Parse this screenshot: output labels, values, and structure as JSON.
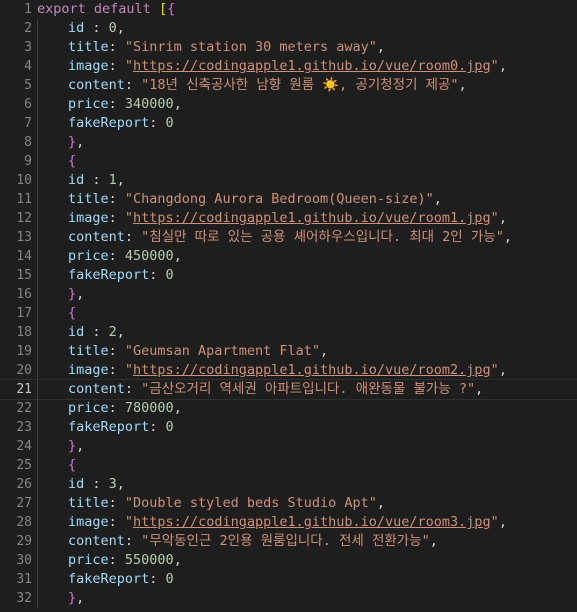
{
  "editor": {
    "active_line": 21,
    "lines": [
      {
        "n": "1",
        "indent": 0,
        "tokens": [
          [
            "kw",
            "export"
          ],
          [
            "punc",
            " "
          ],
          [
            "kw",
            "default"
          ],
          [
            "punc",
            " "
          ],
          [
            "bracket",
            "["
          ],
          [
            "brace",
            "{"
          ]
        ]
      },
      {
        "n": "2",
        "indent": 1,
        "tokens": [
          [
            "prop",
            "id"
          ],
          [
            "punc",
            " : "
          ],
          [
            "num",
            "0"
          ],
          [
            "punc",
            ","
          ]
        ]
      },
      {
        "n": "3",
        "indent": 1,
        "tokens": [
          [
            "prop",
            "title"
          ],
          [
            "punc",
            ": "
          ],
          [
            "str",
            "\"Sinrim station 30 meters away\""
          ],
          [
            "punc",
            ","
          ]
        ]
      },
      {
        "n": "4",
        "indent": 1,
        "tokens": [
          [
            "prop",
            "image"
          ],
          [
            "punc",
            ": "
          ],
          [
            "str",
            "\""
          ],
          [
            "link",
            "https://codingapple1.github.io/vue/room0.jpg"
          ],
          [
            "str",
            "\""
          ],
          [
            "punc",
            ","
          ]
        ]
      },
      {
        "n": "5",
        "indent": 1,
        "tokens": [
          [
            "prop",
            "content"
          ],
          [
            "punc",
            ": "
          ],
          [
            "str",
            "\"18년 신축공사한 남향 원룸 ☀️, 공기청정기 제공\""
          ],
          [
            "punc",
            ","
          ]
        ]
      },
      {
        "n": "6",
        "indent": 1,
        "tokens": [
          [
            "prop",
            "price"
          ],
          [
            "punc",
            ": "
          ],
          [
            "num",
            "340000"
          ],
          [
            "punc",
            ","
          ]
        ]
      },
      {
        "n": "7",
        "indent": 1,
        "tokens": [
          [
            "prop",
            "fakeReport"
          ],
          [
            "punc",
            ": "
          ],
          [
            "num",
            "0"
          ]
        ]
      },
      {
        "n": "8",
        "indent": 1,
        "tokens": [
          [
            "brace",
            "}"
          ],
          [
            "punc",
            ","
          ]
        ]
      },
      {
        "n": "9",
        "indent": 1,
        "tokens": [
          [
            "brace",
            "{"
          ]
        ]
      },
      {
        "n": "10",
        "indent": 1,
        "tokens": [
          [
            "prop",
            "id"
          ],
          [
            "punc",
            " : "
          ],
          [
            "num",
            "1"
          ],
          [
            "punc",
            ","
          ]
        ]
      },
      {
        "n": "11",
        "indent": 1,
        "tokens": [
          [
            "prop",
            "title"
          ],
          [
            "punc",
            ": "
          ],
          [
            "str",
            "\"Changdong Aurora Bedroom(Queen-size)\""
          ],
          [
            "punc",
            ","
          ]
        ]
      },
      {
        "n": "12",
        "indent": 1,
        "tokens": [
          [
            "prop",
            "image"
          ],
          [
            "punc",
            ": "
          ],
          [
            "str",
            "\""
          ],
          [
            "link",
            "https://codingapple1.github.io/vue/room1.jpg"
          ],
          [
            "str",
            "\""
          ],
          [
            "punc",
            ","
          ]
        ]
      },
      {
        "n": "13",
        "indent": 1,
        "tokens": [
          [
            "prop",
            "content"
          ],
          [
            "punc",
            ": "
          ],
          [
            "str",
            "\"침실만 따로 있는 공용 셰어하우스입니다. 최대 2인 가능\""
          ],
          [
            "punc",
            ","
          ]
        ]
      },
      {
        "n": "14",
        "indent": 1,
        "tokens": [
          [
            "prop",
            "price"
          ],
          [
            "punc",
            ": "
          ],
          [
            "num",
            "450000"
          ],
          [
            "punc",
            ","
          ]
        ]
      },
      {
        "n": "15",
        "indent": 1,
        "tokens": [
          [
            "prop",
            "fakeReport"
          ],
          [
            "punc",
            ": "
          ],
          [
            "num",
            "0"
          ]
        ]
      },
      {
        "n": "16",
        "indent": 1,
        "tokens": [
          [
            "brace",
            "}"
          ],
          [
            "punc",
            ","
          ]
        ]
      },
      {
        "n": "17",
        "indent": 1,
        "tokens": [
          [
            "brace",
            "{"
          ]
        ]
      },
      {
        "n": "18",
        "indent": 1,
        "tokens": [
          [
            "prop",
            "id"
          ],
          [
            "punc",
            " : "
          ],
          [
            "num",
            "2"
          ],
          [
            "punc",
            ","
          ]
        ]
      },
      {
        "n": "19",
        "indent": 1,
        "tokens": [
          [
            "prop",
            "title"
          ],
          [
            "punc",
            ": "
          ],
          [
            "str",
            "\"Geumsan Apartment Flat\""
          ],
          [
            "punc",
            ","
          ]
        ]
      },
      {
        "n": "20",
        "indent": 1,
        "tokens": [
          [
            "prop",
            "image"
          ],
          [
            "punc",
            ": "
          ],
          [
            "str",
            "\""
          ],
          [
            "link",
            "https://codingapple1.github.io/vue/room2.jpg"
          ],
          [
            "str",
            "\""
          ],
          [
            "punc",
            ","
          ]
        ]
      },
      {
        "n": "21",
        "indent": 1,
        "tokens": [
          [
            "prop",
            "content"
          ],
          [
            "punc",
            ": "
          ],
          [
            "str",
            "\"금산오거리 역세권 아파트입니다. 애완동물 불가능 ?\""
          ],
          [
            "punc",
            ","
          ]
        ]
      },
      {
        "n": "22",
        "indent": 1,
        "tokens": [
          [
            "prop",
            "price"
          ],
          [
            "punc",
            ": "
          ],
          [
            "num",
            "780000"
          ],
          [
            "punc",
            ","
          ]
        ]
      },
      {
        "n": "23",
        "indent": 1,
        "tokens": [
          [
            "prop",
            "fakeReport"
          ],
          [
            "punc",
            ": "
          ],
          [
            "num",
            "0"
          ]
        ]
      },
      {
        "n": "24",
        "indent": 1,
        "tokens": [
          [
            "brace",
            "}"
          ],
          [
            "punc",
            ","
          ]
        ]
      },
      {
        "n": "25",
        "indent": 1,
        "tokens": [
          [
            "brace",
            "{"
          ]
        ]
      },
      {
        "n": "26",
        "indent": 1,
        "tokens": [
          [
            "prop",
            "id"
          ],
          [
            "punc",
            " : "
          ],
          [
            "num",
            "3"
          ],
          [
            "punc",
            ","
          ]
        ]
      },
      {
        "n": "27",
        "indent": 1,
        "tokens": [
          [
            "prop",
            "title"
          ],
          [
            "punc",
            ": "
          ],
          [
            "str",
            "\"Double styled beds Studio Apt\""
          ],
          [
            "punc",
            ","
          ]
        ]
      },
      {
        "n": "28",
        "indent": 1,
        "tokens": [
          [
            "prop",
            "image"
          ],
          [
            "punc",
            ": "
          ],
          [
            "str",
            "\""
          ],
          [
            "link",
            "https://codingapple1.github.io/vue/room3.jpg"
          ],
          [
            "str",
            "\""
          ],
          [
            "punc",
            ","
          ]
        ]
      },
      {
        "n": "29",
        "indent": 1,
        "tokens": [
          [
            "prop",
            "content"
          ],
          [
            "punc",
            ": "
          ],
          [
            "str",
            "\"무악동인근 2인용 원룸입니다. 전세 전환가능\""
          ],
          [
            "punc",
            ","
          ]
        ]
      },
      {
        "n": "30",
        "indent": 1,
        "tokens": [
          [
            "prop",
            "price"
          ],
          [
            "punc",
            ": "
          ],
          [
            "num",
            "550000"
          ],
          [
            "punc",
            ","
          ]
        ]
      },
      {
        "n": "31",
        "indent": 1,
        "tokens": [
          [
            "prop",
            "fakeReport"
          ],
          [
            "punc",
            ": "
          ],
          [
            "num",
            "0"
          ]
        ]
      },
      {
        "n": "32",
        "indent": 1,
        "tokens": [
          [
            "brace",
            "}"
          ],
          [
            "punc",
            ","
          ]
        ]
      }
    ]
  },
  "colors": {
    "background": "#1e1e1e",
    "keyword": "#c586c0",
    "property": "#9cdcfe",
    "string": "#ce9178",
    "number": "#b5cea8",
    "bracket": "#ffd700",
    "brace": "#da70d6",
    "line_number": "#858585"
  }
}
